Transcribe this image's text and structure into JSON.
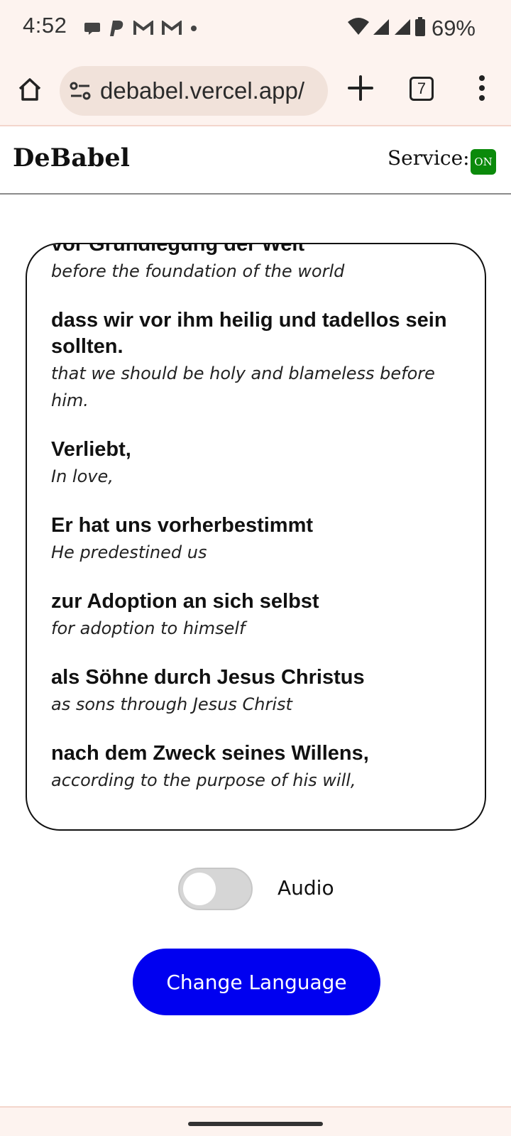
{
  "status_bar": {
    "time": "4:52",
    "notification_icons": [
      "chat-bubble-icon",
      "paypal-icon",
      "gmail-icon",
      "gmail-icon",
      "dot-icon"
    ],
    "system_icons": [
      "wifi-icon",
      "signal-icon",
      "signal-icon",
      "battery-icon"
    ],
    "battery": "69%"
  },
  "browser": {
    "url": "debabel.vercel.app/",
    "tab_count": "7"
  },
  "header": {
    "title": "DeBabel",
    "service_label": "Service:",
    "service_status": "ON",
    "service_status_color": "#0b8a0b"
  },
  "translation_lines": [
    {
      "original": "vor Grundlegung der Welt",
      "translation": "before the foundation of the world"
    },
    {
      "original": "dass wir vor ihm heilig und tadellos sein sollten.",
      "translation": "that we should be holy and blameless before him."
    },
    {
      "original": "Verliebt,",
      "translation": "In love,"
    },
    {
      "original": "Er hat uns vorherbestimmt",
      "translation": "He predestined us"
    },
    {
      "original": "zur Adoption an sich selbst",
      "translation": "for adoption to himself"
    },
    {
      "original": "als Söhne durch Jesus Christus",
      "translation": "as sons through Jesus Christ"
    },
    {
      "original": "nach dem Zweck seines Willens,",
      "translation": "according to the purpose of his will,"
    }
  ],
  "controls": {
    "audio_label": "Audio",
    "audio_enabled": false,
    "change_language_label": "Change Language",
    "accent_color": "#0000f0"
  }
}
